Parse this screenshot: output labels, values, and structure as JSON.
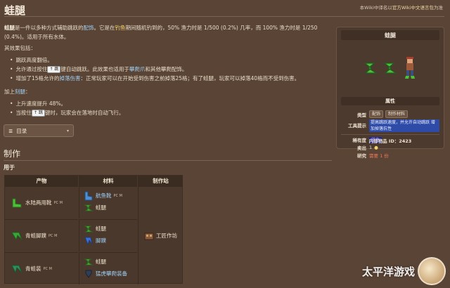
{
  "page": {
    "title": "蛙腿",
    "top_note_prefix": "本Wiki中译名以",
    "top_note_link": "官方Wiki中文语言包",
    "top_note_suffix": "为准"
  },
  "intro": {
    "bold": "蛙腿",
    "t1": "是一件以多种方式辅助跳跃的",
    "l1": "配饰",
    "t2": "。它是在",
    "l2": "钓鱼",
    "t3": "期间随机钓到的，50% 渔力时是 1/500 (0.2%) 几率，而 100% 渔力时是 1/250 (0.4%)。适用于所有水体。"
  },
  "effects_label": "其效果包括：",
  "effects": {
    "e1": "跳跃高度翻倍。",
    "e2_a": "允许通过按住",
    "e2_key": "跳",
    "e2_b": "键自动跳跃。此效果也适用于",
    "e2_l1": "攀爬爪",
    "e2_c": "和其他攀爬配饰。",
    "e3_a": "增加了15格允许的",
    "e3_l1": "掉落伤害",
    "e3_b": "：正常玩家可以在开始受到伤害之前掉落25格；有了蛙腿，玩家可以掉落40格而不受到伤害。"
  },
  "plus_label": "加上",
  "plus_link": "刻腿",
  "plus_items": {
    "p1": "上升速度提升 48%。",
    "p2_a": "当按住",
    "p2_key": "跳",
    "p2_b": "键时，玩家会在落地时自动飞行。"
  },
  "toc": {
    "icon": "≣",
    "label": "目录",
    "caret": "▾"
  },
  "crafting": {
    "heading": "制作",
    "subheading": "用于",
    "headers": {
      "product": "产物",
      "materials": "材料",
      "station": "制作站"
    },
    "rows": [
      {
        "product": "水陆两用靴",
        "product_tags": "PC M",
        "materials": [
          {
            "name": "航鱼靴",
            "tags": "PC M"
          },
          {
            "name": "蛙腿",
            "tags": ""
          }
        ]
      },
      {
        "product": "青蛙脚蹼",
        "product_tags": "PC M",
        "materials": [
          {
            "name": "蛙腿",
            "tags": ""
          },
          {
            "name": "脚蹼",
            "tags": ""
          }
        ]
      },
      {
        "product": "青蛙装",
        "product_tags": "PC M",
        "materials": [
          {
            "name": "蛙腿",
            "tags": ""
          },
          {
            "name": "猛虎攀爬装备",
            "tags": ""
          }
        ]
      }
    ],
    "station_name": "工匠作坊"
  },
  "infobox": {
    "title": "蛙腿",
    "attributes_label": "属性",
    "type_label": "类型",
    "type_values": [
      "配饰",
      "制作材料"
    ],
    "tooltip_label": "工具提示",
    "tooltip_text": "提高跳跃速度，并允许自动跳跃 增加掉落抗性",
    "rarity_label": "稀有度",
    "rarity_value": "蓝色",
    "sell_label": "卖出",
    "sell_value": "1",
    "buy_label": "研究",
    "buy_value": "需要 1 份",
    "id_label": "内部物品 ID：",
    "id_value": "2423"
  },
  "watermark": {
    "text": "太平洋游戏"
  },
  "colors": {
    "background": "#5a4435",
    "link_blue": "#9fd0f5",
    "link_green": "#8fe06a",
    "link_yellow": "#f1d56b",
    "item_green": "#4fbf3a",
    "tooltip_highlight": "#2f4ba8"
  }
}
